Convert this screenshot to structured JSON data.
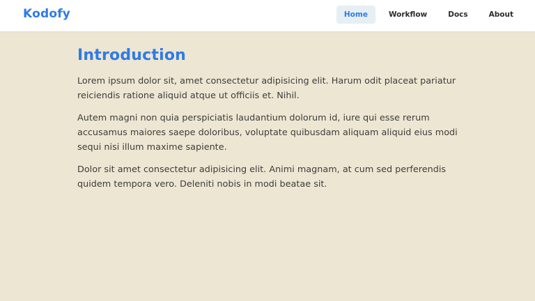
{
  "header": {
    "brand": "Kodofy",
    "nav": [
      {
        "label": "Home",
        "active": true
      },
      {
        "label": "Workflow",
        "active": false
      },
      {
        "label": "Docs",
        "active": false
      },
      {
        "label": "About",
        "active": false
      }
    ]
  },
  "main": {
    "title": "Introduction",
    "paragraphs": [
      "Lorem ipsum dolor sit, amet consectetur adipisicing elit. Harum odit placeat pariatur reiciendis ratione aliquid atque ut officiis et. Nihil.",
      "Autem magni non quia perspiciatis laudantium dolorum id, iure qui esse rerum accusamus maiores saepe doloribus, voluptate quibusdam aliquam aliquid eius modi sequi nisi illum maxime sapiente.",
      "Dolor sit amet consectetur adipisicing elit. Animi magnam, at cum sed perferendis quidem tempora vero. Deleniti nobis in modi beatae sit."
    ]
  },
  "colors": {
    "accent": "#2f7be5",
    "background": "#ede6d2",
    "header_bg": "#ffffff",
    "active_nav_bg": "#e6eff4",
    "text": "#3d3d3d"
  }
}
